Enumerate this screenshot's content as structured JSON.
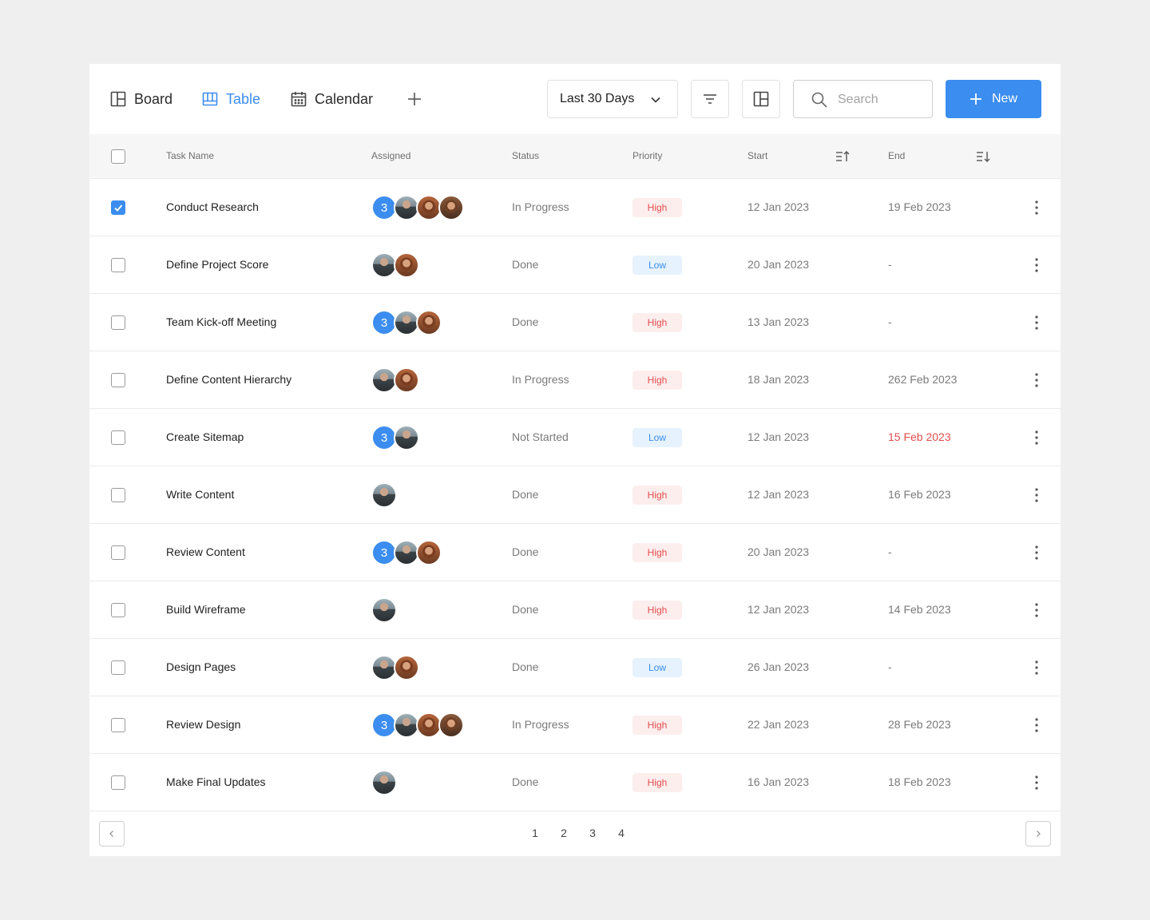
{
  "views": {
    "board": "Board",
    "table": "Table",
    "calendar": "Calendar"
  },
  "toolbar": {
    "range": "Last 30 Days",
    "search_placeholder": "Search",
    "new_label": "New"
  },
  "columns": {
    "task": "Task Name",
    "assigned": "Assigned",
    "status": "Status",
    "priority": "Priority",
    "start": "Start",
    "end": "End"
  },
  "rows": [
    {
      "task": "Conduct Research",
      "checked": true,
      "count": "3",
      "avatars": [
        "man",
        "woman",
        "woman2"
      ],
      "status": "In Progress",
      "priority": "High",
      "start": "12 Jan 2023",
      "end": "19 Feb 2023",
      "overdue": false
    },
    {
      "task": "Define Project Score",
      "checked": false,
      "count": "",
      "avatars": [
        "man",
        "woman"
      ],
      "status": "Done",
      "priority": "Low",
      "start": "20 Jan 2023",
      "end": "-",
      "overdue": false
    },
    {
      "task": "Team Kick-off Meeting",
      "checked": false,
      "count": "3",
      "avatars": [
        "man",
        "woman"
      ],
      "status": "Done",
      "priority": "High",
      "start": "13 Jan 2023",
      "end": "-",
      "overdue": false
    },
    {
      "task": "Define Content Hierarchy",
      "checked": false,
      "count": "",
      "avatars": [
        "man",
        "woman"
      ],
      "status": "In Progress",
      "priority": "High",
      "start": "18 Jan 2023",
      "end": "262 Feb 2023",
      "overdue": false
    },
    {
      "task": "Create Sitemap",
      "checked": false,
      "count": "3",
      "avatars": [
        "man"
      ],
      "status": "Not Started",
      "priority": "Low",
      "start": "12 Jan 2023",
      "end": "15 Feb 2023",
      "overdue": true
    },
    {
      "task": "Write Content",
      "checked": false,
      "count": "",
      "avatars": [
        "man"
      ],
      "status": "Done",
      "priority": "High",
      "start": "12 Jan 2023",
      "end": "16 Feb 2023",
      "overdue": false
    },
    {
      "task": "Review Content",
      "checked": false,
      "count": "3",
      "avatars": [
        "man",
        "woman"
      ],
      "status": "Done",
      "priority": "High",
      "start": "20 Jan 2023",
      "end": "-",
      "overdue": false
    },
    {
      "task": "Build Wireframe",
      "checked": false,
      "count": "",
      "avatars": [
        "man"
      ],
      "status": "Done",
      "priority": "High",
      "start": "12 Jan 2023",
      "end": "14 Feb 2023",
      "overdue": false
    },
    {
      "task": "Design Pages",
      "checked": false,
      "count": "",
      "avatars": [
        "man",
        "woman"
      ],
      "status": "Done",
      "priority": "Low",
      "start": "26 Jan 2023",
      "end": "-",
      "overdue": false
    },
    {
      "task": "Review Design",
      "checked": false,
      "count": "3",
      "avatars": [
        "man",
        "woman",
        "woman2"
      ],
      "status": "In Progress",
      "priority": "High",
      "start": "22 Jan 2023",
      "end": "28 Feb 2023",
      "overdue": false
    },
    {
      "task": "Make Final Updates",
      "checked": false,
      "count": "",
      "avatars": [
        "man"
      ],
      "status": "Done",
      "priority": "High",
      "start": "16 Jan 2023",
      "end": "18 Feb 2023",
      "overdue": false
    }
  ],
  "pagination": {
    "pages": [
      "1",
      "2",
      "3",
      "4"
    ]
  },
  "colors": {
    "accent": "#3b8def",
    "danger": "#e34d4d",
    "page_bg": "#efefef"
  }
}
